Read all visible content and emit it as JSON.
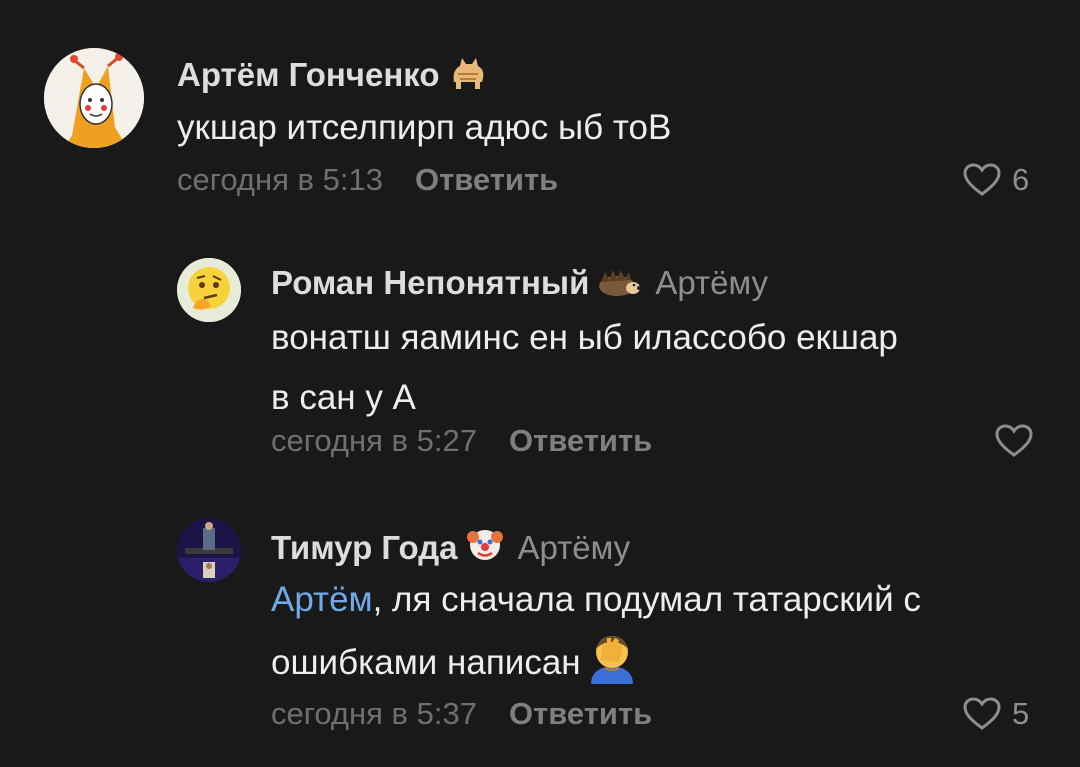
{
  "comments": [
    {
      "author": "Артём Гонченко",
      "badge_icon": "cat-emoji-icon",
      "text": "укшар итселпирп адюс ыб тоВ",
      "time": "сегодня в 5:13",
      "reply_label": "Ответить",
      "likes": "6"
    },
    {
      "author": "Роман Непонятный",
      "badge_icon": "hedgehog-emoji-icon",
      "reply_to": "Артёму",
      "text_line1": "вонатш яаминс ен ыб илассобо екшар",
      "text_line2": "в сан у А",
      "time": "сегодня в 5:27",
      "reply_label": "Ответить"
    },
    {
      "author": "Тимур Года",
      "badge_icon": "clown-emoji-icon",
      "reply_to": "Артёму",
      "mention": "Артём",
      "text_line1": ", ля сначала подумал татарский с",
      "text_line2": "ошибками написан",
      "inline_emoji": "facepalm-emoji-icon",
      "time": "сегодня в 5:37",
      "reply_label": "Ответить",
      "likes": "5"
    }
  ],
  "colors": {
    "background": "#191919",
    "text": "#ebedf0",
    "secondary": "#8c8e91",
    "mention": "#71aaeb"
  }
}
